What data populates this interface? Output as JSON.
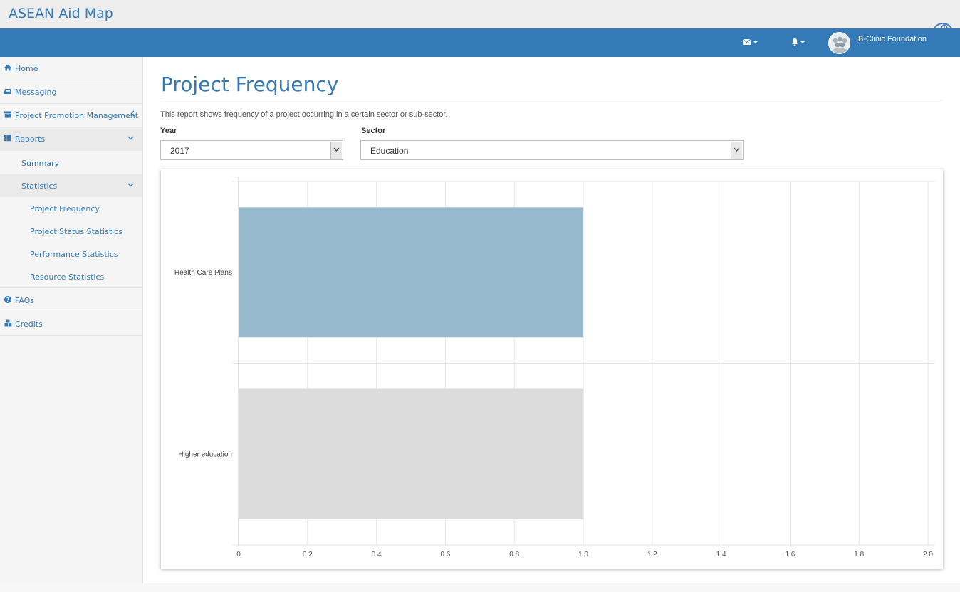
{
  "app": {
    "title": "ASEAN Aid Map"
  },
  "navbar": {
    "mail_icon": "envelope-icon",
    "bell_icon": "bell-icon",
    "user_name": "B-Clinic Foundation"
  },
  "sidebar": {
    "items": [
      {
        "label": "Home",
        "icon": "home-icon"
      },
      {
        "label": "Messaging",
        "icon": "inbox-icon"
      },
      {
        "label": "Project Promotion Management",
        "icon": "archive-icon"
      },
      {
        "label": "Reports",
        "icon": "list-icon"
      },
      {
        "label": "FAQs",
        "icon": "question-circle-icon"
      },
      {
        "label": "Credits",
        "icon": "cubes-icon"
      }
    ],
    "reports_sub": [
      {
        "label": "Summary"
      },
      {
        "label": "Statistics"
      }
    ],
    "statistics_sub": [
      {
        "label": "Project Frequency"
      },
      {
        "label": "Project Status Statistics"
      },
      {
        "label": "Performance Statistics"
      },
      {
        "label": "Resource Statistics"
      }
    ]
  },
  "main": {
    "title": "Project Frequency",
    "description": "This report shows frequency of a project occurring in a certain sector or sub-sector.",
    "year": {
      "label": "Year",
      "value": "2017"
    },
    "sector": {
      "label": "Sector",
      "value": "Education"
    }
  },
  "chart_data": {
    "type": "bar",
    "orientation": "horizontal",
    "categories": [
      "Health Care Plans",
      "Higher education"
    ],
    "values": [
      1.0,
      1.0
    ],
    "colors": [
      "#97b9cd",
      "#dcdcdc"
    ],
    "xlim": [
      0,
      2.0
    ],
    "xticks": [
      "0",
      "0.2",
      "0.4",
      "0.6",
      "0.8",
      "1.0",
      "1.2",
      "1.4",
      "1.6",
      "1.8",
      "2.0"
    ],
    "grid": true
  },
  "colors": {
    "brand": "#337ab7",
    "topbar": "#ededed"
  }
}
